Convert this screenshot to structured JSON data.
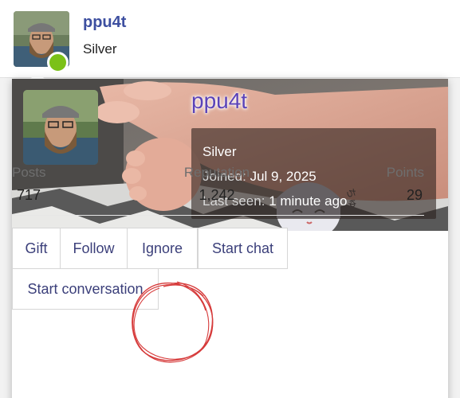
{
  "header": {
    "username": "ppu4t",
    "rank": "Silver",
    "online": true
  },
  "popup": {
    "banner_username": "ppu4t",
    "rank": "Silver",
    "joined_label": "Joined:",
    "joined_value": "Jul 9, 2025",
    "last_seen_label": "Last seen:",
    "last_seen_value": "1 minute ago",
    "stats": [
      {
        "label": "Posts",
        "value": "717"
      },
      {
        "label": "Reputation",
        "value": "1,242"
      },
      {
        "label": "Points",
        "value": "29"
      }
    ],
    "buttons": {
      "gift": "Gift",
      "follow": "Follow",
      "ignore": "Ignore",
      "start_chat": "Start chat",
      "start_conversation": "Start conversation"
    }
  },
  "colors": {
    "username": "#3d4fa0",
    "online_dot": "#7bc118",
    "button_text": "#3b3f7a",
    "annotation_ink": "#d63a3a"
  }
}
